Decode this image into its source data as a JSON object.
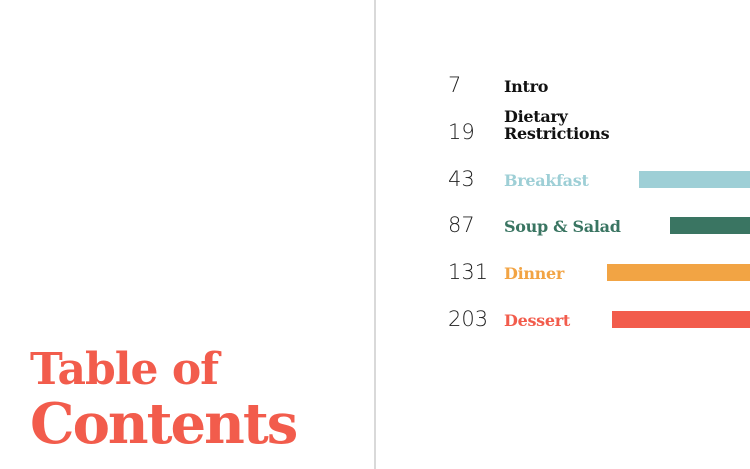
{
  "title": {
    "line1": "Table of",
    "line2": "Contents",
    "color": "#f25c4c"
  },
  "entries": [
    {
      "page": "7",
      "label": "Intro",
      "color": "#111111"
    },
    {
      "page": "19",
      "label": "Dietary",
      "label2": "Restrictions",
      "color": "#111111"
    },
    {
      "page": "43",
      "label": "Breakfast",
      "color": "#9ecfd6"
    },
    {
      "page": "87",
      "label": "Soup & Salad",
      "color": "#3a7562"
    },
    {
      "page": "131",
      "label": "Dinner",
      "color": "#f2a444"
    },
    {
      "page": "203",
      "label": "Dessert",
      "color": "#f25c4c"
    }
  ]
}
